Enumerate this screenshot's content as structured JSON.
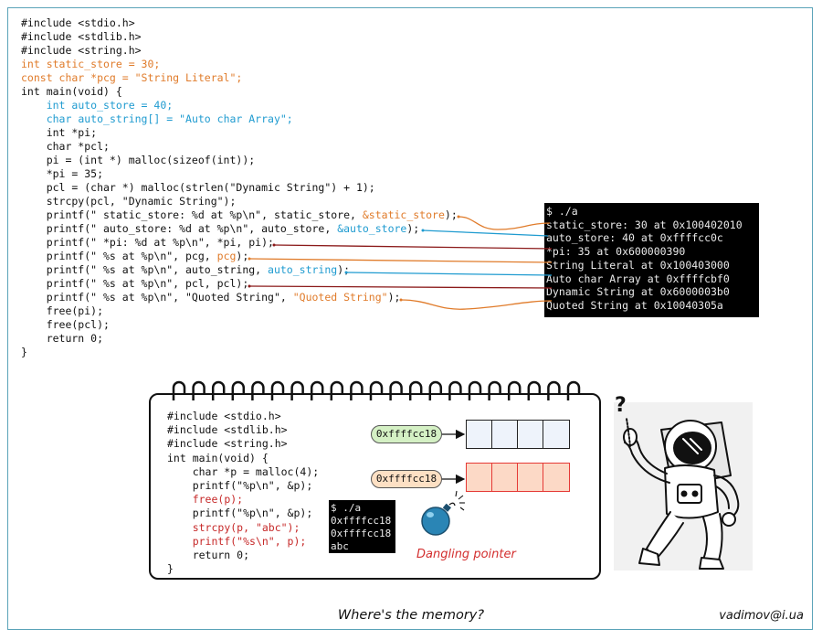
{
  "code_top": [
    {
      "segments": [
        {
          "text": "#include <stdio.h>"
        }
      ]
    },
    {
      "segments": [
        {
          "text": "#include <stdlib.h>"
        }
      ]
    },
    {
      "segments": [
        {
          "text": "#include <string.h>"
        }
      ]
    },
    {
      "segments": [
        {
          "text": "int static_store = 30;",
          "color": "orange"
        }
      ]
    },
    {
      "segments": [
        {
          "text": "const char *pcg = \"String Literal\";",
          "color": "orange"
        }
      ]
    },
    {
      "segments": [
        {
          "text": "int main(void) {"
        }
      ]
    },
    {
      "segments": [
        {
          "text": "    "
        },
        {
          "text": "int auto_store = 40;",
          "color": "blue"
        }
      ]
    },
    {
      "segments": [
        {
          "text": "    "
        },
        {
          "text": "char auto_string[] = \"Auto char Array\";",
          "color": "blue"
        }
      ]
    },
    {
      "segments": [
        {
          "text": "    int *pi;"
        }
      ]
    },
    {
      "segments": [
        {
          "text": "    char *pcl;"
        }
      ]
    },
    {
      "segments": [
        {
          "text": "    pi = (int *) malloc(sizeof(int));"
        }
      ]
    },
    {
      "segments": [
        {
          "text": "    *pi = 35;"
        }
      ]
    },
    {
      "segments": [
        {
          "text": "    pcl = (char *) malloc(strlen(\"Dynamic String\") + 1);"
        }
      ]
    },
    {
      "segments": [
        {
          "text": "    strcpy(pcl, \"Dynamic String\");"
        }
      ]
    },
    {
      "segments": [
        {
          "text": "    printf(\" static_store: %d at %p\\n\", static_store, "
        },
        {
          "text": "&static_store",
          "color": "orange"
        },
        {
          "text": ");"
        }
      ]
    },
    {
      "segments": [
        {
          "text": "    printf(\" auto_store: %d at %p\\n\", auto_store, "
        },
        {
          "text": "&auto_store",
          "color": "blue"
        },
        {
          "text": ");"
        }
      ]
    },
    {
      "segments": [
        {
          "text": "    printf(\" *pi: %d at %p\\n\", *pi, pi);"
        }
      ]
    },
    {
      "segments": [
        {
          "text": "    printf(\" %s at %p\\n\", pcg, "
        },
        {
          "text": "pcg",
          "color": "orange"
        },
        {
          "text": ");"
        }
      ]
    },
    {
      "segments": [
        {
          "text": "    printf(\" %s at %p\\n\", auto_string, "
        },
        {
          "text": "auto_string",
          "color": "blue"
        },
        {
          "text": ");"
        }
      ]
    },
    {
      "segments": [
        {
          "text": "    printf(\" %s at %p\\n\", pcl, pcl);"
        }
      ]
    },
    {
      "segments": [
        {
          "text": "    printf(\" %s at %p\\n\", \"Quoted String\", "
        },
        {
          "text": "\"Quoted String\"",
          "color": "orange"
        },
        {
          "text": ");"
        }
      ]
    },
    {
      "segments": [
        {
          "text": "    free(pi);"
        }
      ]
    },
    {
      "segments": [
        {
          "text": "    free(pcl);"
        }
      ]
    },
    {
      "segments": [
        {
          "text": "    return 0;"
        }
      ]
    },
    {
      "segments": [
        {
          "text": "}"
        }
      ]
    }
  ],
  "terminal_top": {
    "lines": [
      "$ ./a",
      "static_store: 30 at 0x100402010",
      "auto_store: 40 at 0xffffcc0c",
      "*pi: 35 at 0x600000390",
      "String Literal at 0x100403000",
      "Auto char Array at 0xffffcbf0",
      "Dynamic String at 0x6000003b0",
      "Quoted String at 0x10040305a"
    ]
  },
  "code_notebook": [
    {
      "segments": [
        {
          "text": "#include <stdio.h>"
        }
      ]
    },
    {
      "segments": [
        {
          "text": "#include <stdlib.h>"
        }
      ]
    },
    {
      "segments": [
        {
          "text": "#include <string.h>"
        }
      ]
    },
    {
      "segments": [
        {
          "text": "int main(void) {"
        }
      ]
    },
    {
      "segments": [
        {
          "text": "    char *p = malloc(4);"
        }
      ]
    },
    {
      "segments": [
        {
          "text": "    printf(\"%p\\n\", &p);"
        }
      ]
    },
    {
      "segments": [
        {
          "text": "    "
        },
        {
          "text": "free(p);",
          "color": "red"
        }
      ]
    },
    {
      "segments": [
        {
          "text": "    printf(\"%p\\n\", &p);"
        }
      ]
    },
    {
      "segments": [
        {
          "text": "    "
        },
        {
          "text": "strcpy(p, \"abc\");",
          "color": "red"
        }
      ]
    },
    {
      "segments": [
        {
          "text": "    "
        },
        {
          "text": "printf(\"%s\\n\", p);",
          "color": "red"
        }
      ]
    },
    {
      "segments": [
        {
          "text": "    return 0;"
        }
      ]
    },
    {
      "segments": [
        {
          "text": "}"
        }
      ]
    }
  ],
  "terminal_notebook": {
    "lines": [
      "$ ./a",
      "0xffffcc18",
      "0xffffcc18",
      "abc"
    ]
  },
  "pointer_top": "0xffffcc18",
  "pointer_bottom": "0xffffcc18",
  "dangling_label": "Dangling pointer",
  "question_mark": "?",
  "caption": "Where's the memory?",
  "signature": "vadimov@i.ua",
  "colors": {
    "orange": "#e07b2a",
    "blue": "#1f9bd0",
    "red": "#c62828",
    "dark_red": "#8b1a1a",
    "frame": "#5aa3b8",
    "green_pill": "#d4f0c4",
    "orange_pill": "#fde0c4"
  },
  "icons": [
    "bomb-icon",
    "astronaut-illustration"
  ]
}
